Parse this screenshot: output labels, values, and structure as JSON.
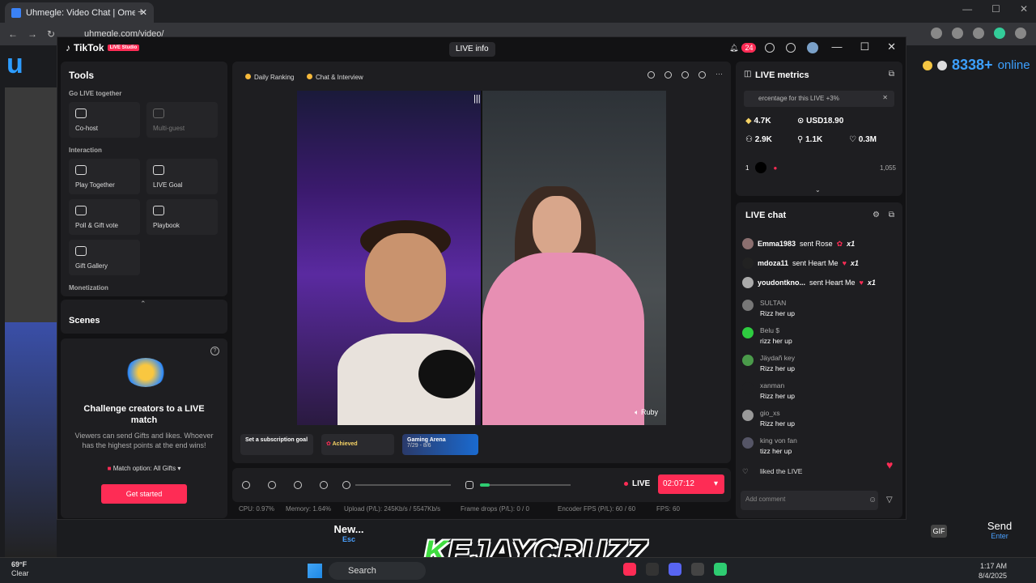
{
  "browser": {
    "tab_title": "Uhmegle: Video Chat | Ome",
    "url": "uhmegle.com/video/"
  },
  "site": {
    "online_count": "8338+",
    "online_label": "online",
    "new_label": "New...",
    "new_key": "Esc",
    "send_label": "Send",
    "send_key": "Enter",
    "gif_label": "GIF",
    "overlay_k": "K",
    "overlay_rest": "EJAYCRUZZ"
  },
  "tiktok": {
    "brand": "TikTok",
    "badge": "LIVE Studio",
    "live_info": "LIVE info",
    "notif_count": "24"
  },
  "tools": {
    "title": "Tools",
    "sec_go_live": "Go LIVE together",
    "cohost": "Co-host",
    "multiguest": "Multi-guest",
    "sec_interaction": "Interaction",
    "play_together": "Play Together",
    "live_goal": "LIVE Goal",
    "poll": "Poll & Gift vote",
    "playbook": "Playbook",
    "gift_gallery": "Gift Gallery",
    "sec_monetization": "Monetization"
  },
  "scenes": {
    "title": "Scenes"
  },
  "challenge": {
    "title": "Challenge creators to a LIVE match",
    "desc": "Viewers can send Gifts and likes. Whoever has the highest points at the end wins!",
    "option": "Match option: All Gifts",
    "button": "Get started"
  },
  "center": {
    "chip_ranking": "Daily Ranking",
    "chip_chat": "Chat & Interview",
    "guest_name": "Ruby",
    "goal_sub": "Set a subscription goal",
    "goal_achieved": "Achieved",
    "goal_arena": "Gaming Arena",
    "goal_arena_dates": "7/29 - 8/6"
  },
  "bottom": {
    "live": "LIVE",
    "timer": "02:07:12"
  },
  "stats": {
    "cpu": "CPU: 0.97%",
    "memory": "Memory: 1.64%",
    "upload": "Upload (P/L): 245Kb/s / 5547Kb/s",
    "frame": "Frame drops (P/L): 0 / 0",
    "encoder": "Encoder FPS (P/L): 60 / 60",
    "fps": "FPS: 60"
  },
  "metrics": {
    "title": "LIVE metrics",
    "percentage": "ercentage for this LIVE +3%",
    "diamonds": "4.7K",
    "usd": "USD18.90",
    "viewers": "2.9K",
    "followers": "1.1K",
    "likes": "0.3M",
    "rank": "1",
    "rank_count": "1,055"
  },
  "chat": {
    "title": "LIVE chat",
    "gifts": [
      {
        "user": "Emma1983",
        "action": "sent Rose",
        "count": "x1"
      },
      {
        "user": "mdoza11",
        "action": "sent Heart Me",
        "count": "x1"
      },
      {
        "user": "youdontkno...",
        "action": "sent Heart Me",
        "count": "x1"
      }
    ],
    "messages": [
      {
        "user": "SULTAN",
        "text": "Rizz her up"
      },
      {
        "user": "Belu $",
        "text": "rizz her up"
      },
      {
        "user": "Jäydañ key",
        "text": "Rizz her up"
      },
      {
        "user": "xanman",
        "text": "Rizz her up"
      },
      {
        "user": "gio_xs",
        "text": "Rizz her up"
      },
      {
        "user": "king von fan",
        "text": "tizz her up"
      }
    ],
    "liked": "liked the LIVE",
    "add_comment": "Add comment"
  },
  "taskbar": {
    "temp": "69°F",
    "cond": "Clear",
    "search": "Search",
    "time": "1:17 AM",
    "date": "8/4/2025"
  }
}
